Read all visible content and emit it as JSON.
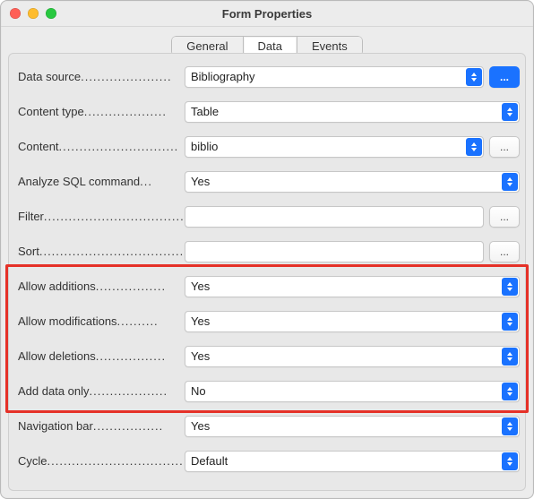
{
  "window": {
    "title": "Form Properties"
  },
  "tabs": {
    "general": "General",
    "data": "Data",
    "events": "Events",
    "active": "data"
  },
  "more": "...",
  "rows": {
    "datasource": {
      "label": "Data source",
      "value": "Bibliography"
    },
    "contenttype": {
      "label": "Content type",
      "value": "Table"
    },
    "content": {
      "label": "Content",
      "value": "biblio"
    },
    "analyzesql": {
      "label": "Analyze SQL command",
      "value": "Yes"
    },
    "filter": {
      "label": "Filter",
      "value": ""
    },
    "sort": {
      "label": "Sort",
      "value": ""
    },
    "allowadd": {
      "label": "Allow additions",
      "value": "Yes"
    },
    "allowmod": {
      "label": "Allow modifications",
      "value": "Yes"
    },
    "allowdel": {
      "label": "Allow deletions",
      "value": "Yes"
    },
    "adddataonly": {
      "label": "Add data only",
      "value": "No"
    },
    "navbar": {
      "label": "Navigation bar",
      "value": "Yes"
    },
    "cycle": {
      "label": "Cycle",
      "value": "Default"
    }
  }
}
